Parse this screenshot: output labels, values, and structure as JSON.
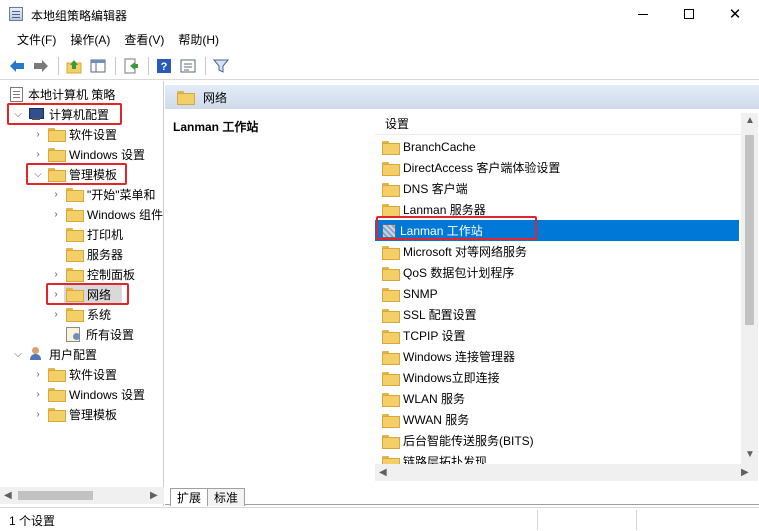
{
  "window": {
    "title": "本地组策略编辑器"
  },
  "menu": [
    "文件(F)",
    "操作(A)",
    "查看(V)",
    "帮助(H)"
  ],
  "toolbar_icons": [
    "back-arrow-icon",
    "forward-arrow-icon",
    "up-folder-icon",
    "show-hide-tree-icon",
    "export-list-icon",
    "help-icon",
    "properties-icon",
    "filter-icon"
  ],
  "tree": {
    "root": "本地计算机 策略",
    "computer_config": "计算机配置",
    "software_settings": "软件设置",
    "windows_settings": "Windows 设置",
    "admin_templates": "管理模板",
    "start_menu": "\"开始\"菜单和",
    "windows_components": "Windows 组件",
    "printers": "打印机",
    "servers": "服务器",
    "control_panel": "控制面板",
    "network": "网络",
    "system": "系统",
    "all_settings": "所有设置",
    "user_config": "用户配置",
    "user_software_settings": "软件设置",
    "user_windows_settings": "Windows 设置",
    "user_admin_templates": "管理模板"
  },
  "right_pane": {
    "path_title": "网络",
    "description_title": "Lanman 工作站",
    "column_header": "设置",
    "items": [
      {
        "label": "BranchCache",
        "type": "folder"
      },
      {
        "label": "DirectAccess 客户端体验设置",
        "type": "folder"
      },
      {
        "label": "DNS 客户端",
        "type": "folder"
      },
      {
        "label": "Lanman 服务器",
        "type": "folder"
      },
      {
        "label": "Lanman 工作站",
        "type": "setting"
      },
      {
        "label": "Microsoft 对等网络服务",
        "type": "folder"
      },
      {
        "label": "QoS 数据包计划程序",
        "type": "folder"
      },
      {
        "label": "SNMP",
        "type": "folder"
      },
      {
        "label": "SSL 配置设置",
        "type": "folder"
      },
      {
        "label": "TCPIP 设置",
        "type": "folder"
      },
      {
        "label": "Windows 连接管理器",
        "type": "folder"
      },
      {
        "label": "Windows立即连接",
        "type": "folder"
      },
      {
        "label": "WLAN 服务",
        "type": "folder"
      },
      {
        "label": "WWAN 服务",
        "type": "folder"
      },
      {
        "label": "后台智能传送服务(BITS)",
        "type": "folder"
      },
      {
        "label": "链路层拓扑发现",
        "type": "folder"
      }
    ]
  },
  "tabs": [
    "扩展",
    "标准"
  ],
  "status": {
    "text": "1 个设置"
  },
  "colors": {
    "selection": "#0078d7",
    "highlight_box": "#e3242b",
    "folder": "#f4cf68"
  }
}
